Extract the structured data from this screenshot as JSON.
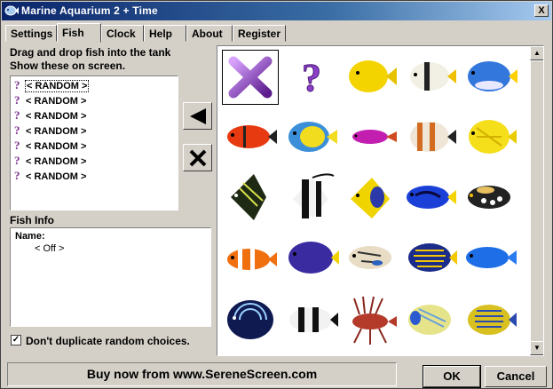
{
  "window": {
    "title": "Marine Aquarium 2 + Time"
  },
  "tabs": [
    {
      "label": "Settings",
      "active": false
    },
    {
      "label": "Fish",
      "active": true
    },
    {
      "label": "Clock",
      "active": false
    },
    {
      "label": "Help",
      "active": false
    },
    {
      "label": "About",
      "active": false
    },
    {
      "label": "Register",
      "active": false
    }
  ],
  "instructions": {
    "line1": "Drag and drop fish into the tank",
    "line2": "Show these on screen."
  },
  "shown_list": [
    "< RANDOM >",
    "< RANDOM >",
    "< RANDOM >",
    "< RANDOM >",
    "< RANDOM >",
    "< RANDOM >",
    "< RANDOM >"
  ],
  "fish_info": {
    "heading": "Fish Info",
    "name_label": "Name:",
    "name_value": "< Off >"
  },
  "checkbox": {
    "label": "Don't duplicate random choices.",
    "checked": true,
    "mark": "✓"
  },
  "footer": {
    "buy": "Buy now from www.SereneScreen.com",
    "ok": "OK",
    "cancel": "Cancel"
  },
  "close_glyph": "X",
  "random_glyph": "?",
  "colors": {
    "title_start": "#0a246a",
    "title_end": "#a6caf0",
    "accent_purple": "#7b2f8f"
  }
}
